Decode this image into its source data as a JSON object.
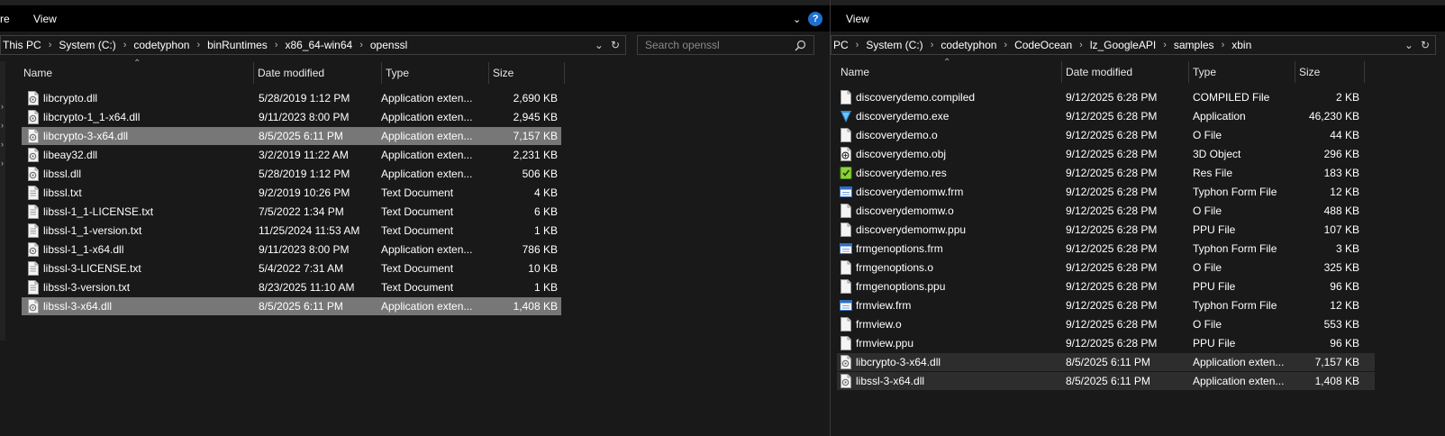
{
  "left": {
    "menu": [
      "re",
      "View"
    ],
    "address": [
      "This PC",
      "System (C:)",
      "codetyphon",
      "binRuntimes",
      "x86_64-win64",
      "openssl"
    ],
    "search_placeholder": "Search openssl",
    "columns": [
      "Name",
      "Date modified",
      "Type",
      "Size"
    ],
    "files": [
      {
        "name": "libcrypto.dll",
        "date": "5/28/2019 1:12 PM",
        "type": "Application exten...",
        "size": "2,690 KB",
        "icon": "dll-icon"
      },
      {
        "name": "libcrypto-1_1-x64.dll",
        "date": "9/11/2023 8:00 PM",
        "type": "Application exten...",
        "size": "2,945 KB",
        "icon": "dll-icon"
      },
      {
        "name": "libcrypto-3-x64.dll",
        "date": "8/5/2025 6:11 PM",
        "type": "Application exten...",
        "size": "7,157 KB",
        "icon": "dll-icon",
        "selected": true
      },
      {
        "name": "libeay32.dll",
        "date": "3/2/2019 11:22 AM",
        "type": "Application exten...",
        "size": "2,231 KB",
        "icon": "dll-icon"
      },
      {
        "name": "libssl.dll",
        "date": "5/28/2019 1:12 PM",
        "type": "Application exten...",
        "size": "506 KB",
        "icon": "dll-icon"
      },
      {
        "name": "libssl.txt",
        "date": "9/2/2019 10:26 PM",
        "type": "Text Document",
        "size": "4 KB",
        "icon": "text-file-icon"
      },
      {
        "name": "libssl-1_1-LICENSE.txt",
        "date": "7/5/2022 1:34 PM",
        "type": "Text Document",
        "size": "6 KB",
        "icon": "text-file-icon"
      },
      {
        "name": "libssl-1_1-version.txt",
        "date": "11/25/2024 11:53 AM",
        "type": "Text Document",
        "size": "1 KB",
        "icon": "text-file-icon"
      },
      {
        "name": "libssl-1_1-x64.dll",
        "date": "9/11/2023 8:00 PM",
        "type": "Application exten...",
        "size": "786 KB",
        "icon": "dll-icon"
      },
      {
        "name": "libssl-3-LICENSE.txt",
        "date": "5/4/2022 7:31 AM",
        "type": "Text Document",
        "size": "10 KB",
        "icon": "text-file-icon"
      },
      {
        "name": "libssl-3-version.txt",
        "date": "8/23/2025 11:10 AM",
        "type": "Text Document",
        "size": "1 KB",
        "icon": "text-file-icon"
      },
      {
        "name": "libssl-3-x64.dll",
        "date": "8/5/2025 6:11 PM",
        "type": "Application exten...",
        "size": "1,408 KB",
        "icon": "dll-icon",
        "selected": true
      }
    ]
  },
  "right": {
    "menu": [
      "View"
    ],
    "address": [
      "PC",
      "System (C:)",
      "codetyphon",
      "CodeOcean",
      "lz_GoogleAPI",
      "samples",
      "xbin"
    ],
    "columns": [
      "Name",
      "Date modified",
      "Type",
      "Size"
    ],
    "files": [
      {
        "name": "discoverydemo.compiled",
        "date": "9/12/2025 6:28 PM",
        "type": "COMPILED File",
        "size": "2 KB",
        "icon": "file-icon"
      },
      {
        "name": "discoverydemo.exe",
        "date": "9/12/2025 6:28 PM",
        "type": "Application",
        "size": "46,230 KB",
        "icon": "typhon-app-icon"
      },
      {
        "name": "discoverydemo.o",
        "date": "9/12/2025 6:28 PM",
        "type": "O File",
        "size": "44 KB",
        "icon": "file-icon"
      },
      {
        "name": "discoverydemo.obj",
        "date": "9/12/2025 6:28 PM",
        "type": "3D Object",
        "size": "296 KB",
        "icon": "3d-object-icon"
      },
      {
        "name": "discoverydemo.res",
        "date": "9/12/2025 6:28 PM",
        "type": "Res File",
        "size": "183 KB",
        "icon": "res-file-icon"
      },
      {
        "name": "discoverydemomw.frm",
        "date": "9/12/2025 6:28 PM",
        "type": "Typhon Form File",
        "size": "12 KB",
        "icon": "form-file-icon"
      },
      {
        "name": "discoverydemomw.o",
        "date": "9/12/2025 6:28 PM",
        "type": "O File",
        "size": "488 KB",
        "icon": "file-icon"
      },
      {
        "name": "discoverydemomw.ppu",
        "date": "9/12/2025 6:28 PM",
        "type": "PPU File",
        "size": "107 KB",
        "icon": "file-icon"
      },
      {
        "name": "frmgenoptions.frm",
        "date": "9/12/2025 6:28 PM",
        "type": "Typhon Form File",
        "size": "3 KB",
        "icon": "form-file-icon"
      },
      {
        "name": "frmgenoptions.o",
        "date": "9/12/2025 6:28 PM",
        "type": "O File",
        "size": "325 KB",
        "icon": "file-icon"
      },
      {
        "name": "frmgenoptions.ppu",
        "date": "9/12/2025 6:28 PM",
        "type": "PPU File",
        "size": "96 KB",
        "icon": "file-icon"
      },
      {
        "name": "frmview.frm",
        "date": "9/12/2025 6:28 PM",
        "type": "Typhon Form File",
        "size": "12 KB",
        "icon": "form-file-icon"
      },
      {
        "name": "frmview.o",
        "date": "9/12/2025 6:28 PM",
        "type": "O File",
        "size": "553 KB",
        "icon": "file-icon"
      },
      {
        "name": "frmview.ppu",
        "date": "9/12/2025 6:28 PM",
        "type": "PPU File",
        "size": "96 KB",
        "icon": "file-icon"
      },
      {
        "name": "libcrypto-3-x64.dll",
        "date": "8/5/2025 6:11 PM",
        "type": "Application exten...",
        "size": "7,157 KB",
        "icon": "dll-icon",
        "highlighted": true
      },
      {
        "name": "libssl-3-x64.dll",
        "date": "8/5/2025 6:11 PM",
        "type": "Application exten...",
        "size": "1,408 KB",
        "icon": "dll-icon",
        "highlighted": true
      }
    ]
  }
}
